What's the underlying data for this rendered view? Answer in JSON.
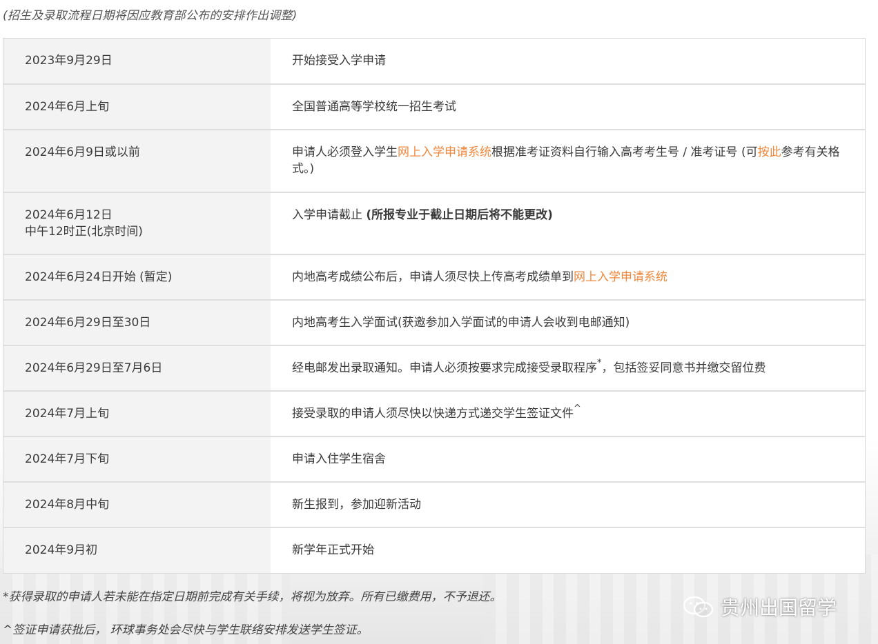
{
  "top_note": "(招生及录取流程日期将因应教育部公布的安排作出调整)",
  "rows": [
    {
      "date": "2023年9月29日",
      "desc": [
        "开始接受入学申请"
      ]
    },
    {
      "date": "2024年6月上旬",
      "desc": [
        "全国普通高等学校统一招生考试"
      ]
    },
    {
      "date": "2024年6月9日或以前",
      "desc": [
        "申请人必须登入学生",
        "网上入学申请系统",
        "根据准考证资料自行输入高考考生号 / 准考证号 (可",
        "按此",
        "参考有关格式。)"
      ]
    },
    {
      "date": "2024年6月12日",
      "date2": "中午12时正(北京时间)",
      "desc": [
        "入学申请截止 ",
        "(所报专业于截止日期后将不能更改)"
      ]
    },
    {
      "date": "2024年6月24日开始 (暂定)",
      "desc": [
        "内地高考成绩公布后，申请人须尽快上传高考成绩单到",
        "网上入学申请系统"
      ]
    },
    {
      "date": "2024年6月29日至30日",
      "desc": [
        "内地高考生入学面试(获邀参加入学面试的申请人会收到电邮通知)"
      ]
    },
    {
      "date": "2024年6月29日至7月6日",
      "desc": [
        "经电邮发出录取通知。申请人必须按要求完成接受录取程序",
        "*",
        "，包括签妥同意书并缴交留位费"
      ]
    },
    {
      "date": "2024年7月上旬",
      "desc": [
        "接受录取的申请人须尽快以快递方式递交学生签证文件",
        "^"
      ]
    },
    {
      "date": "2024年7月下旬",
      "desc": [
        "申请入住学生宿舍"
      ]
    },
    {
      "date": "2024年8月中旬",
      "desc": [
        "新生报到，参加迎新活动"
      ]
    },
    {
      "date": "2024年9月初",
      "desc": [
        "新学年正式开始"
      ]
    }
  ],
  "footnotes": [
    "*获得录取的申请人若未能在指定日期前完成有关手续，将视为放弃。所有已缴费用，不予退还。",
    "^签证申请获批后， 环球事务处会尽快与学生联络安排发送学生签证。"
  ],
  "watermark": {
    "text": "贵州出国留学",
    "icon": "wechat-icon"
  },
  "colors": {
    "link": "#f0883c",
    "date_bg": "#f3f3f3",
    "border": "#dedede"
  }
}
